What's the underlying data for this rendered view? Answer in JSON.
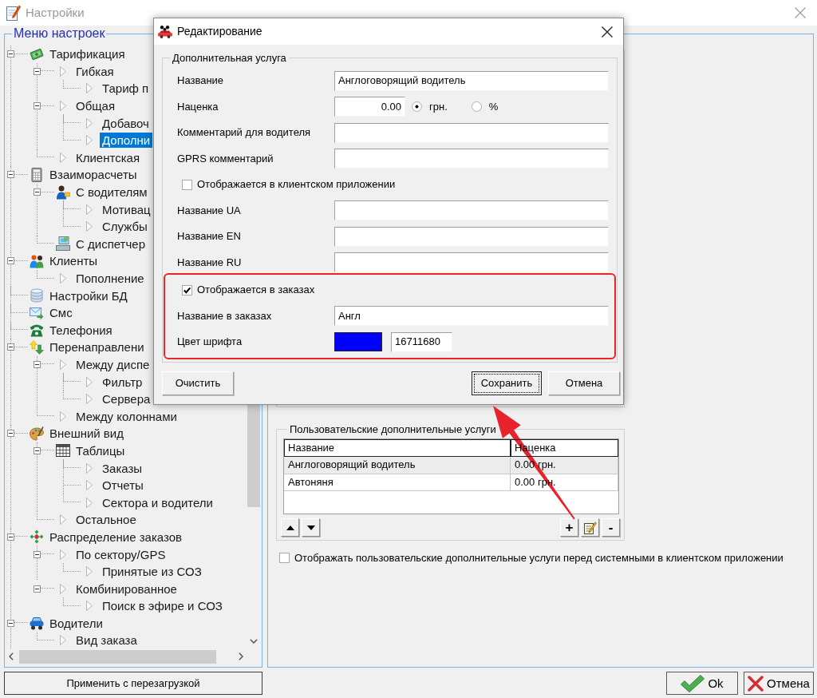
{
  "window": {
    "title": "Настройки"
  },
  "menu": {
    "title": "Меню настроек",
    "items": [
      {
        "label": "Тарификация",
        "expanded": true,
        "selected": false,
        "children": [
          {
            "label": "Гибкая",
            "expanded": true,
            "selected": false,
            "children": [
              {
                "label": "Тариф п",
                "selected": false
              }
            ]
          },
          {
            "label": "Общая",
            "expanded": true,
            "selected": false,
            "children": [
              {
                "label": "Добавоч",
                "selected": false
              },
              {
                "label": "Дополни",
                "selected": true
              }
            ]
          },
          {
            "label": "Клиентская",
            "selected": false
          }
        ]
      },
      {
        "label": "Взаиморасчеты",
        "expanded": true,
        "selected": false,
        "children": [
          {
            "label": "С водителям",
            "expanded": true,
            "selected": false,
            "children": [
              {
                "label": "Мотивац",
                "selected": false
              },
              {
                "label": "Службы",
                "selected": false
              }
            ]
          },
          {
            "label": "С диспетчер",
            "selected": false
          }
        ]
      },
      {
        "label": "Клиенты",
        "expanded": true,
        "selected": false,
        "children": [
          {
            "label": "Пополнение",
            "selected": false
          }
        ]
      },
      {
        "label": "Настройки БД",
        "selected": false
      },
      {
        "label": "Смс",
        "selected": false
      },
      {
        "label": "Телефония",
        "selected": false
      },
      {
        "label": "Перенаправлени",
        "expanded": true,
        "selected": false,
        "children": [
          {
            "label": "Между диспе",
            "expanded": true,
            "selected": false,
            "children": [
              {
                "label": "Фильтр",
                "selected": false
              },
              {
                "label": "Сервера",
                "selected": false
              }
            ]
          },
          {
            "label": "Между колоннами",
            "selected": false
          }
        ]
      },
      {
        "label": "Внешний вид",
        "expanded": true,
        "selected": false,
        "children": [
          {
            "label": "Таблицы",
            "expanded": true,
            "selected": false,
            "children": [
              {
                "label": "Заказы",
                "selected": false
              },
              {
                "label": "Отчеты",
                "selected": false
              },
              {
                "label": "Сектора и водители",
                "selected": false
              }
            ]
          },
          {
            "label": "Остальное",
            "selected": false
          }
        ]
      },
      {
        "label": "Распределение заказов",
        "expanded": true,
        "selected": false,
        "children": [
          {
            "label": "По сектору/GPS",
            "expanded": true,
            "selected": false,
            "children": [
              {
                "label": "Принятые из СОЗ",
                "selected": false
              }
            ]
          },
          {
            "label": "Комбинированное",
            "expanded": true,
            "selected": false,
            "children": [
              {
                "label": "Поиск в эфире и СОЗ",
                "selected": false
              }
            ]
          }
        ]
      },
      {
        "label": "Водители",
        "expanded": true,
        "selected": false,
        "children": [
          {
            "label": "Вид заказа",
            "selected": false
          }
        ]
      }
    ]
  },
  "apply_button": "Применить с перезагрузкой",
  "services": {
    "title": "Пользовательские дополнительные услуги",
    "columns": [
      "Название",
      "Наценка"
    ],
    "rows": [
      {
        "cells": [
          "Англоговорящий водитель",
          "0.00 грн."
        ],
        "selected": true
      },
      {
        "cells": [
          "Автоняня",
          "0.00 грн."
        ],
        "selected": false
      }
    ],
    "left_buttons": [
      {
        "kind": "up"
      },
      {
        "kind": "down"
      }
    ],
    "right_buttons": [
      {
        "kind": "add",
        "label": "+"
      },
      {
        "kind": "edit"
      },
      {
        "kind": "remove",
        "label": "-"
      }
    ]
  },
  "show_custom_first": {
    "label": "Отображать пользовательские дополнительные услуги перед системными в клиентском приложении",
    "checked": false
  },
  "footer_buttons": [
    {
      "kind": "ok",
      "label": "Ok"
    },
    {
      "kind": "cancel",
      "label": "Отмена"
    }
  ],
  "dialog": {
    "title": "Редактирование",
    "group_title": "Дополнительная услуга",
    "sections": [
      {
        "highlighted": false,
        "rows": [
          {
            "kind": "text",
            "label": "Название",
            "value": "Англоговорящий водитель"
          },
          {
            "kind": "amount",
            "label": "Наценка",
            "value": "0.00",
            "options": [
              {
                "label": "грн.",
                "selected": true
              },
              {
                "label": "%",
                "selected": false
              }
            ]
          },
          {
            "kind": "text",
            "label": "Комментарий для водителя"
          },
          {
            "kind": "text",
            "label": "GPRS комментарий"
          },
          {
            "kind": "check",
            "label": "Отображается в клиентском приложении",
            "checked": false
          },
          {
            "kind": "text",
            "label": "Название UA"
          },
          {
            "kind": "text",
            "label": "Название EN"
          },
          {
            "kind": "text",
            "label": "Название RU"
          }
        ]
      },
      {
        "highlighted": true,
        "rows": [
          {
            "kind": "check",
            "label": "Отображается в заказах",
            "checked": true
          },
          {
            "kind": "text",
            "label": "Название в заказах",
            "value": "Англ"
          },
          {
            "kind": "color",
            "label": "Цвет шрифта",
            "color": "#0000ff",
            "value": "16711680"
          }
        ]
      }
    ],
    "left_buttons": [
      {
        "label": "Очистить",
        "focused": false
      }
    ],
    "right_buttons": [
      {
        "label": "Сохранить",
        "focused": true
      },
      {
        "label": "Отмена",
        "focused": false
      }
    ]
  }
}
